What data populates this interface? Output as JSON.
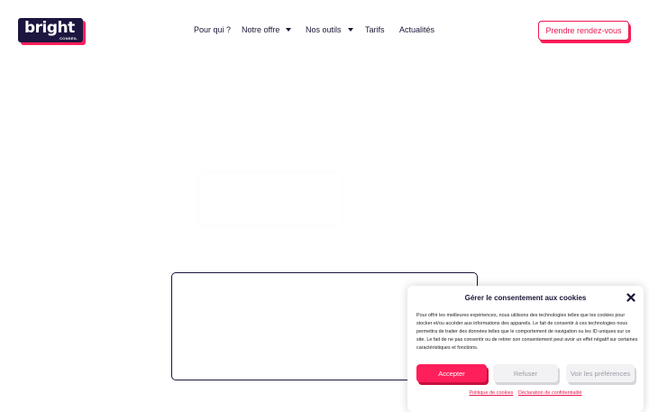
{
  "brand": {
    "logo_word": "bright",
    "logo_sub": "CONSEIL",
    "dark": "#1c1640",
    "accent": "#ff1f5a"
  },
  "nav": {
    "items": [
      {
        "label": "Pour qui ?",
        "dropdown": false
      },
      {
        "label": "Notre offre",
        "dropdown": true
      },
      {
        "label": "Nos outils",
        "dropdown": true
      },
      {
        "label": "Tarifs",
        "dropdown": false
      },
      {
        "label": "Actualités",
        "dropdown": false
      }
    ],
    "cta_label": "Prendre rendez-vous"
  },
  "cookie_banner": {
    "title": "Gérer le consentement aux cookies",
    "text": "Pour offrir les meilleures expériences, nous utilisons des technologies telles que les cookies pour stocker et/ou accéder aux informations des appareils. Le fait de consentir à ces technologies nous permettra de traiter des données telles que le comportement de navigation ou les ID uniques sur ce site. Le fait de ne pas consentir ou de retirer son consentement peut avoir un effet négatif sur certaines caractéristiques et fonctions.",
    "accept_label": "Accepter",
    "refuse_label": "Refuser",
    "prefs_label": "Voir les préférences",
    "policy_link": "Politique de cookies",
    "privacy_link": "Déclaration de confidentialité",
    "close_icon": "close-icon"
  }
}
